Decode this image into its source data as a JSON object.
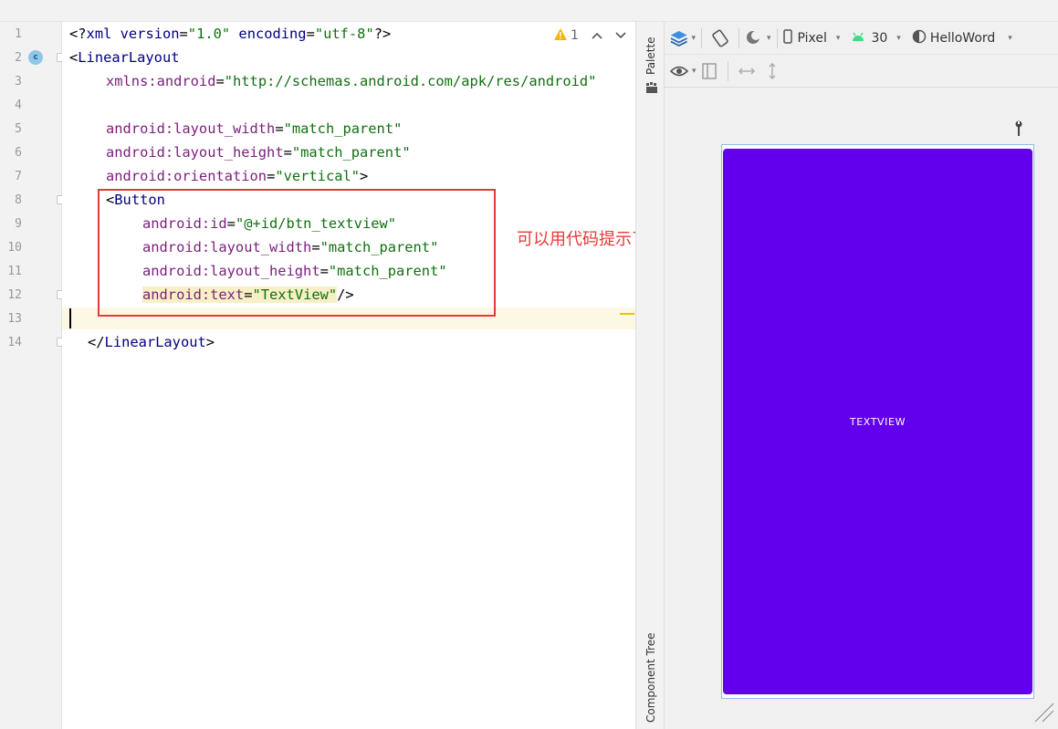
{
  "editor": {
    "line_numbers": [
      "1",
      "2",
      "3",
      "4",
      "5",
      "6",
      "7",
      "8",
      "9",
      "10",
      "11",
      "12",
      "13",
      "14"
    ],
    "gutter_badge": "c",
    "warnings": {
      "count": "1"
    },
    "l1": {
      "open": "<?",
      "tag": "xml",
      "s1": " ",
      "a1": "version",
      "eq1": "=",
      "v1": "\"1.0\"",
      "s2": " ",
      "a2": "encoding",
      "eq2": "=",
      "v2": "\"utf-8\"",
      "close": "?>"
    },
    "l2": {
      "open": "<",
      "tag": "LinearLayout"
    },
    "l3": {
      "attr": "xmlns:android",
      "eq": "=",
      "val": "\"http://schemas.android.com/apk/res/android\""
    },
    "l5": {
      "attr": "android:layout_width",
      "eq": "=",
      "val": "\"match_parent\""
    },
    "l6": {
      "attr": "android:layout_height",
      "eq": "=",
      "val": "\"match_parent\""
    },
    "l7": {
      "attr": "android:orientation",
      "eq": "=",
      "val": "\"vertical\"",
      "close": ">"
    },
    "l8": {
      "open": "<",
      "tag": "Button"
    },
    "l9": {
      "attr": "android:id",
      "eq": "=",
      "val": "\"@+id/btn_textview\""
    },
    "l10": {
      "attr": "android:layout_width",
      "eq": "=",
      "val": "\"match_parent\""
    },
    "l11": {
      "attr": "android:layout_height",
      "eq": "=",
      "val": "\"match_parent\""
    },
    "l12": {
      "attr": "android:text",
      "eq": "=",
      "val": "\"TextView\"",
      "close": "/>"
    },
    "l14": {
      "open": "</",
      "tag": "LinearLayout",
      "close": ">"
    }
  },
  "annotation": {
    "text": "可以用代码提示了",
    "color": "#e53935"
  },
  "side_tabs": {
    "palette": "Palette",
    "component_tree": "Component Tree"
  },
  "design_toolbar": {
    "device": "Pixel",
    "api_level": "30",
    "theme": "HelloWord"
  },
  "preview": {
    "button_text": "TEXTVIEW",
    "button_color": "#6200ee"
  },
  "colors": {
    "tag": "#000080",
    "attribute": "#7a1f7a",
    "value": "#107010",
    "current_line": "#fdf8e3"
  },
  "icons": [
    "warning-icon",
    "chevron-up-icon",
    "chevron-down-icon",
    "class-badge-icon",
    "bulb-icon",
    "layers-icon",
    "orientation-icon",
    "night-mode-icon",
    "phone-icon",
    "android-icon",
    "theme-icon",
    "eye-icon",
    "blueprint-icon",
    "horizontal-arrow-icon",
    "vertical-arrow-icon",
    "wrench-icon",
    "resize-handle-icon"
  ]
}
